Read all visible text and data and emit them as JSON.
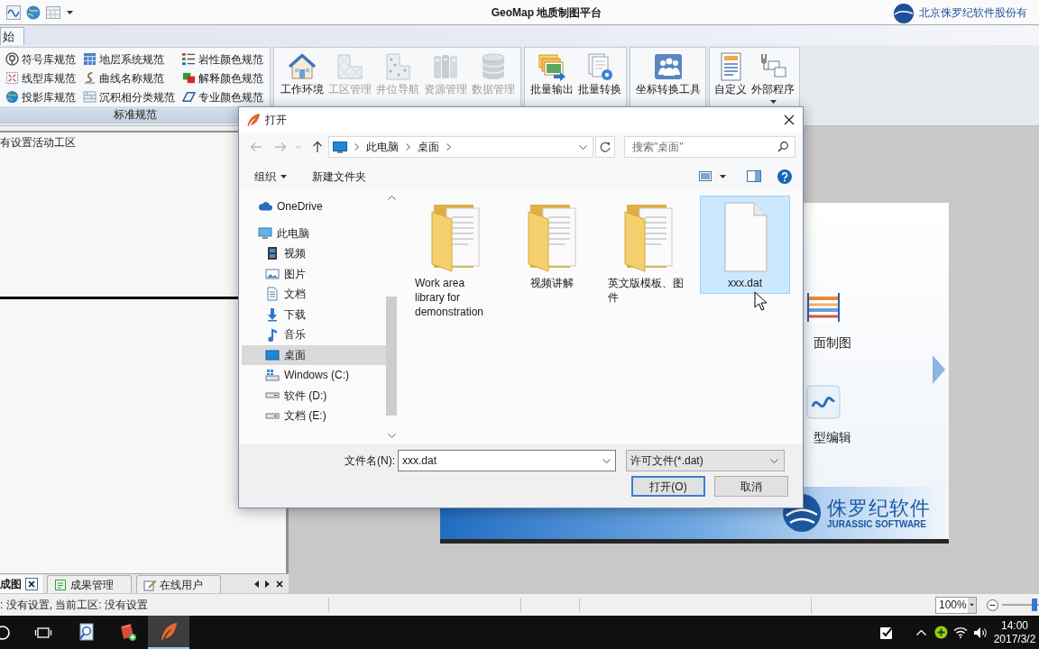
{
  "title_bar": {
    "title": "GeoMap 地质制图平台",
    "brand": "北京侏罗纪软件股份有"
  },
  "ribbon": {
    "tabs": [
      {
        "label": "始",
        "selected": true
      }
    ],
    "groups": [
      {
        "kind": "small",
        "label": "标准规范",
        "columns": [
          {
            "items": [
              {
                "label": "符号库规范"
              },
              {
                "label": "线型库规范"
              },
              {
                "label": "投影库规范"
              }
            ]
          },
          {
            "items": [
              {
                "label": "地层系统规范"
              },
              {
                "label": "曲线名称规范"
              },
              {
                "label": "沉积相分类规范"
              }
            ]
          },
          {
            "items": [
              {
                "label": "岩性颜色规范"
              },
              {
                "label": "解释颜色规范"
              },
              {
                "label": "专业颜色规范"
              }
            ]
          }
        ]
      },
      {
        "kind": "large",
        "items": [
          {
            "label": "工作环境",
            "disabled": false
          },
          {
            "label": "工区管理",
            "disabled": true
          },
          {
            "label": "井位导航",
            "disabled": true
          },
          {
            "label": "资源管理",
            "disabled": true
          },
          {
            "label": "数据管理",
            "disabled": true
          }
        ]
      },
      {
        "kind": "large",
        "items": [
          {
            "label": "批量输出"
          },
          {
            "label": "批量转换"
          }
        ]
      },
      {
        "kind": "large",
        "items": [
          {
            "label": "坐标转换工具"
          }
        ]
      },
      {
        "kind": "large",
        "items": [
          {
            "label": "自定义",
            "dropdown": false
          },
          {
            "label": "外部程序",
            "dropdown": true
          }
        ]
      }
    ]
  },
  "side_panel": {
    "message": "有设置活动工区",
    "tabs": [
      {
        "label": "成图",
        "kind": "map",
        "selected": true
      },
      {
        "label": "成果管理",
        "kind": "results",
        "selected": false
      },
      {
        "label": "在线用户",
        "kind": "users",
        "selected": false
      }
    ]
  },
  "workspace": {
    "welcome": {
      "items": [
        {
          "label": "面制图",
          "kind": "profile"
        },
        {
          "label": "型编辑",
          "kind": "curve"
        }
      ],
      "brand": "侏罗纪软件",
      "brand_en": "JURASSIC SOFTWARE"
    }
  },
  "dialog": {
    "title": "打开",
    "path": [
      "此电脑",
      "桌面"
    ],
    "search": {
      "placeholder": "搜索\"桌面\""
    },
    "toolbar": {
      "organize": "组织",
      "new_folder": "新建文件夹"
    },
    "nav": [
      {
        "label": "OneDrive",
        "kind": "cloud",
        "selected": false
      },
      {
        "label": "此电脑",
        "kind": "pc",
        "selected": false,
        "children": [
          {
            "label": "视频",
            "kind": "videos",
            "selected": false
          },
          {
            "label": "图片",
            "kind": "pictures",
            "selected": false
          },
          {
            "label": "文档",
            "kind": "documents",
            "selected": false
          },
          {
            "label": "下载",
            "kind": "downloads",
            "selected": false
          },
          {
            "label": "音乐",
            "kind": "music",
            "selected": false
          },
          {
            "label": "桌面",
            "kind": "desktop",
            "selected": true
          },
          {
            "label": "Windows (C:)",
            "kind": "system",
            "selected": false
          },
          {
            "label": "软件 (D:)",
            "kind": "drive",
            "selected": false
          },
          {
            "label": "文档 (E:)",
            "kind": "drive",
            "selected": false
          }
        ]
      }
    ],
    "files": [
      {
        "name": "Work area library for demonstration",
        "kind": "folder",
        "selected": false
      },
      {
        "name": "视频讲解",
        "kind": "folder",
        "selected": false
      },
      {
        "name": "英文版模板、图件",
        "kind": "folder",
        "selected": false
      },
      {
        "name": "xxx.dat",
        "kind": "file",
        "selected": true
      }
    ],
    "filename": {
      "label": "文件名(N):",
      "value": "xxx.dat"
    },
    "filter": {
      "value": "许可文件(*.dat)"
    },
    "buttons": [
      {
        "label": "打开(O)",
        "default": true
      },
      {
        "label": "取消",
        "default": false
      }
    ]
  },
  "status_bar": {
    "text": ": 没有设置, 当前工区: 没有设置",
    "zoom": "100%",
    "zoom_slider": {
      "level": 0.95
    }
  },
  "taskbar": {
    "apps": [
      {
        "kind": "viewer",
        "active": false
      },
      {
        "kind": "notes",
        "active": false
      },
      {
        "kind": "geomap",
        "active": true
      }
    ],
    "time": "14:00",
    "date": "2017/3/2"
  }
}
